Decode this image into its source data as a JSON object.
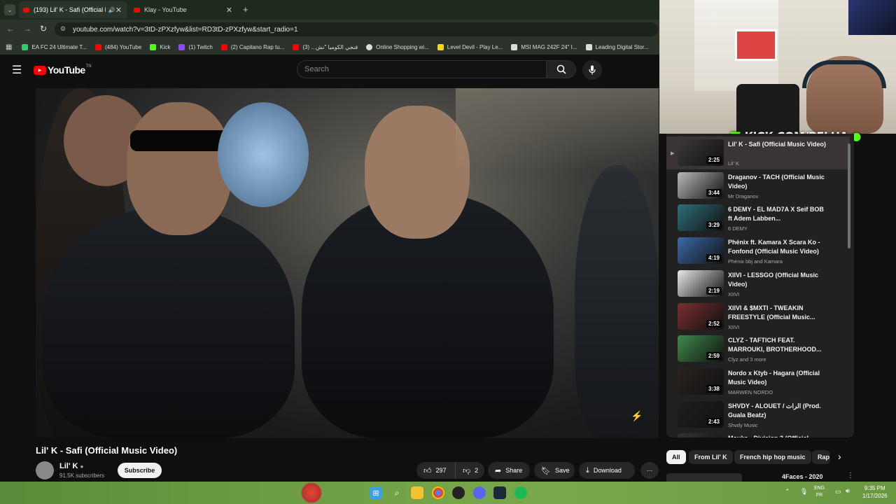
{
  "browser": {
    "tabs": [
      {
        "title": "(193) Lil' K - Safi (Official M",
        "active": true
      },
      {
        "title": "Klay - YouTube",
        "active": false
      }
    ],
    "url": "youtube.com/watch?v=3tD-zPXzfyw&list=RD3tD-zPXzfyw&start_radio=1",
    "bookmarks": [
      {
        "label": "EA FC 24 Ultimate T...",
        "color": "#2ecc71"
      },
      {
        "label": "(484) YouTube",
        "color": "#ff0000"
      },
      {
        "label": "Kick",
        "color": "#53fc18"
      },
      {
        "label": "(1) Twitch",
        "color": "#9146ff"
      },
      {
        "label": "(2) Capitano Rap tu...",
        "color": "#ff0000"
      },
      {
        "label": "فنجي الكوميا \"نش... (3)",
        "color": "#ff0000"
      },
      {
        "label": "Online Shopping wi...",
        "color": "#dddddd"
      },
      {
        "label": "Level Devil - Play Le...",
        "color": "#f5d90a"
      },
      {
        "label": "MSI MAG 242F 24\" I...",
        "color": "#dddddd"
      },
      {
        "label": "Leading Digital Stor...",
        "color": "#dddddd"
      }
    ]
  },
  "youtube": {
    "logo": "YouTube",
    "logo_sup": "TN",
    "search_placeholder": "Search"
  },
  "video": {
    "title": "Lil' K - Safi (Official Music Video)",
    "channel": "Lil' K",
    "subscribers": "91.5K subscribers",
    "subscribe_label": "Subscribe",
    "likes": "297",
    "dislikes": "2",
    "share_label": "Share",
    "save_label": "Save",
    "download_label": "Download"
  },
  "overlay": {
    "kick_text": "KICK.COM/BELHA"
  },
  "playlist": [
    {
      "title": "Lil' K - Safi (Official Music Video)",
      "channel": "Lil' K",
      "duration": "2:25",
      "active": true,
      "thumb": "#3a3a3a"
    },
    {
      "title": "Draganov - TACH (Official Music Video)",
      "channel": "Mr Draganov",
      "duration": "3:44",
      "active": false,
      "thumb": "#b8b8b8"
    },
    {
      "title": "6 DEMY - EL MAD7A X Seif BOB ft Adem Labben...",
      "channel": "6 DEMY",
      "duration": "3:29",
      "active": false,
      "thumb": "#2f6f7a"
    },
    {
      "title": "Phénix ft. Kamara X Scara Ko - Fonfond (Official Music Video)",
      "channel": "Phénix bbj and Kamara",
      "duration": "4:19",
      "active": false,
      "thumb": "#3b6aa8"
    },
    {
      "title": "XIIVI - LESSGO (Official Music Video)",
      "channel": "XIIVI",
      "duration": "2:19",
      "active": false,
      "thumb": "#e8e8e8"
    },
    {
      "title": "XIIVI & $MXTI - TWEAKIN FREESTYLE (Official Music...",
      "channel": "XIIVI",
      "duration": "2:52",
      "active": false,
      "thumb": "#7a2f2f"
    },
    {
      "title": "CLYZ - TAFTICH FEAT. MARROUKI, BROTHERHOOD...",
      "channel": "Clyz and 3 more",
      "duration": "2:59",
      "active": false,
      "thumb": "#3f8a4a"
    },
    {
      "title": "Nordo x Ktyb - Hagara (Official Music Video)",
      "channel": "MARWEN NORDO",
      "duration": "3:38",
      "active": false,
      "thumb": "#2a2320"
    },
    {
      "title": "SHVDY - ALOUET / الرات (Prod. Guala Beatz)",
      "channel": "Shvdy Music",
      "duration": "2:43",
      "active": false,
      "thumb": "#1f1f1f"
    },
    {
      "title": "Mouka - Division 3 (Official",
      "channel": "",
      "duration": "",
      "active": false,
      "thumb": "#333333"
    }
  ],
  "chips": [
    "All",
    "From Lil' K",
    "French hip hop music",
    "Rap"
  ],
  "next_video_title": "4Faces - 2020",
  "taskbar": {
    "lang_top": "ENG",
    "lang_bottom": "FR",
    "time": "9:35 PM",
    "date": "1/17/2026"
  }
}
